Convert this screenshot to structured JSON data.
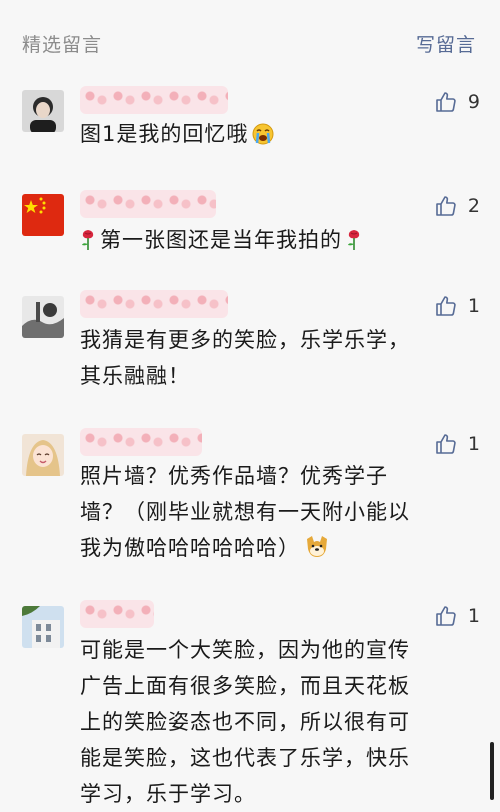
{
  "header": {
    "title": "精选留言",
    "write_label": "写留言"
  },
  "comments": [
    {
      "likes": "9",
      "text": "图1是我的回忆哦",
      "emoji": "crying-face-icon"
    },
    {
      "likes": "2",
      "text": "第一张图还是当年我拍的",
      "emoji": "rose-icon"
    },
    {
      "likes": "1",
      "line1": "我猜是有更多的笑脸，乐学乐学，",
      "line2": "其乐融融！"
    },
    {
      "likes": "1",
      "line1": "照片墙？优秀作品墙？优秀学子",
      "line2": "墙？（刚毕业就想有一天附小能以",
      "line3": "我为傲哈哈哈哈哈哈）",
      "emoji": "doge-icon"
    },
    {
      "likes": "1",
      "line1": "可能是一个大笑脸，因为他的宣传",
      "line2": "广告上面有很多笑脸，而且天花板",
      "line3": "上的笑脸姿态也不同，所以很有可",
      "line4": "能是笑脸，这也代表了乐学，快乐",
      "line5": "学习，乐于学习。"
    }
  ],
  "colors": {
    "link": "#576b95",
    "muted": "#8c8c8c",
    "text": "#1a1a1a",
    "background": "#f7f7f7"
  }
}
